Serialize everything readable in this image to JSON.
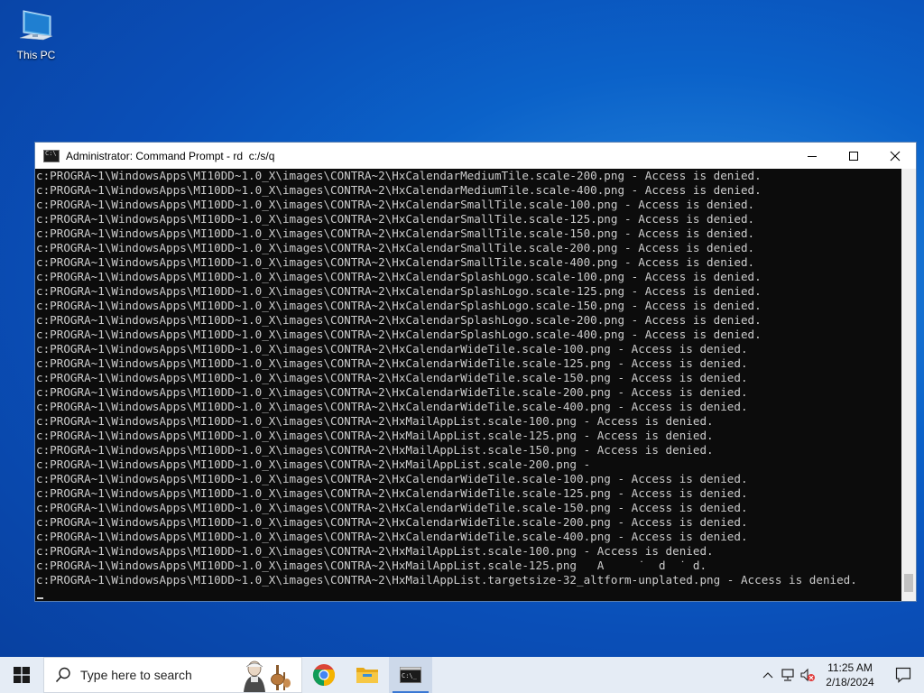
{
  "desktop": {
    "icons": [
      {
        "label": "This PC",
        "icon": "computer-icon"
      }
    ]
  },
  "window": {
    "title": "Administrator: Command Prompt - rd  c:/s/q",
    "controls": [
      "minimize-icon",
      "maximize-icon",
      "close-icon"
    ],
    "console_lines": [
      "c:PROGRA~1\\WindowsApps\\MI10DD~1.0_X\\images\\CONTRA~2\\HxCalendarMediumTile.scale-200.png - Access is denied.",
      "c:PROGRA~1\\WindowsApps\\MI10DD~1.0_X\\images\\CONTRA~2\\HxCalendarMediumTile.scale-400.png - Access is denied.",
      "c:PROGRA~1\\WindowsApps\\MI10DD~1.0_X\\images\\CONTRA~2\\HxCalendarSmallTile.scale-100.png - Access is denied.",
      "c:PROGRA~1\\WindowsApps\\MI10DD~1.0_X\\images\\CONTRA~2\\HxCalendarSmallTile.scale-125.png - Access is denied.",
      "c:PROGRA~1\\WindowsApps\\MI10DD~1.0_X\\images\\CONTRA~2\\HxCalendarSmallTile.scale-150.png - Access is denied.",
      "c:PROGRA~1\\WindowsApps\\MI10DD~1.0_X\\images\\CONTRA~2\\HxCalendarSmallTile.scale-200.png - Access is denied.",
      "c:PROGRA~1\\WindowsApps\\MI10DD~1.0_X\\images\\CONTRA~2\\HxCalendarSmallTile.scale-400.png - Access is denied.",
      "c:PROGRA~1\\WindowsApps\\MI10DD~1.0_X\\images\\CONTRA~2\\HxCalendarSplashLogo.scale-100.png - Access is denied.",
      "c:PROGRA~1\\WindowsApps\\MI10DD~1.0_X\\images\\CONTRA~2\\HxCalendarSplashLogo.scale-125.png - Access is denied.",
      "c:PROGRA~1\\WindowsApps\\MI10DD~1.0_X\\images\\CONTRA~2\\HxCalendarSplashLogo.scale-150.png - Access is denied.",
      "c:PROGRA~1\\WindowsApps\\MI10DD~1.0_X\\images\\CONTRA~2\\HxCalendarSplashLogo.scale-200.png - Access is denied.",
      "c:PROGRA~1\\WindowsApps\\MI10DD~1.0_X\\images\\CONTRA~2\\HxCalendarSplashLogo.scale-400.png - Access is denied.",
      "c:PROGRA~1\\WindowsApps\\MI10DD~1.0_X\\images\\CONTRA~2\\HxCalendarWideTile.scale-100.png - Access is denied.",
      "c:PROGRA~1\\WindowsApps\\MI10DD~1.0_X\\images\\CONTRA~2\\HxCalendarWideTile.scale-125.png - Access is denied.",
      "c:PROGRA~1\\WindowsApps\\MI10DD~1.0_X\\images\\CONTRA~2\\HxCalendarWideTile.scale-150.png - Access is denied.",
      "c:PROGRA~1\\WindowsApps\\MI10DD~1.0_X\\images\\CONTRA~2\\HxCalendarWideTile.scale-200.png - Access is denied.",
      "c:PROGRA~1\\WindowsApps\\MI10DD~1.0_X\\images\\CONTRA~2\\HxCalendarWideTile.scale-400.png - Access is denied.",
      "c:PROGRA~1\\WindowsApps\\MI10DD~1.0_X\\images\\CONTRA~2\\HxMailAppList.scale-100.png - Access is denied.",
      "c:PROGRA~1\\WindowsApps\\MI10DD~1.0_X\\images\\CONTRA~2\\HxMailAppList.scale-125.png - Access is denied.",
      "c:PROGRA~1\\WindowsApps\\MI10DD~1.0_X\\images\\CONTRA~2\\HxMailAppList.scale-150.png - Access is denied.",
      "c:PROGRA~1\\WindowsApps\\MI10DD~1.0_X\\images\\CONTRA~2\\HxMailAppList.scale-200.png -",
      "c:PROGRA~1\\WindowsApps\\MI10DD~1.0_X\\images\\CONTRA~2\\HxCalendarWideTile.scale-100.png - Access is denied.",
      "c:PROGRA~1\\WindowsApps\\MI10DD~1.0_X\\images\\CONTRA~2\\HxCalendarWideTile.scale-125.png - Access is denied.",
      "c:PROGRA~1\\WindowsApps\\MI10DD~1.0_X\\images\\CONTRA~2\\HxCalendarWideTile.scale-150.png - Access is denied.",
      "c:PROGRA~1\\WindowsApps\\MI10DD~1.0_X\\images\\CONTRA~2\\HxCalendarWideTile.scale-200.png - Access is denied.",
      "c:PROGRA~1\\WindowsApps\\MI10DD~1.0_X\\images\\CONTRA~2\\HxCalendarWideTile.scale-400.png - Access is denied.",
      "c:PROGRA~1\\WindowsApps\\MI10DD~1.0_X\\images\\CONTRA~2\\HxMailAppList.scale-100.png - Access is denied.",
      "c:PROGRA~1\\WindowsApps\\MI10DD~1.0_X\\images\\CONTRA~2\\HxMailAppList.scale-125.png   A     ˙  d  ˙ d.",
      "c:PROGRA~1\\WindowsApps\\MI10DD~1.0_X\\images\\CONTRA~2\\HxMailAppList.targetsize-32_altform-unplated.png - Access is denied."
    ]
  },
  "taskbar": {
    "search_placeholder": "Type here to search",
    "apps": [
      {
        "name": "chrome-icon",
        "active": false
      },
      {
        "name": "file-explorer-icon",
        "active": false
      },
      {
        "name": "command-prompt-icon",
        "active": true
      }
    ],
    "tray_icons": [
      "chevron-up-icon",
      "network-icon",
      "volume-muted-icon"
    ],
    "clock": {
      "time": "11:25 AM",
      "date": "2/18/2024"
    },
    "notification_icon": "notification-icon"
  }
}
